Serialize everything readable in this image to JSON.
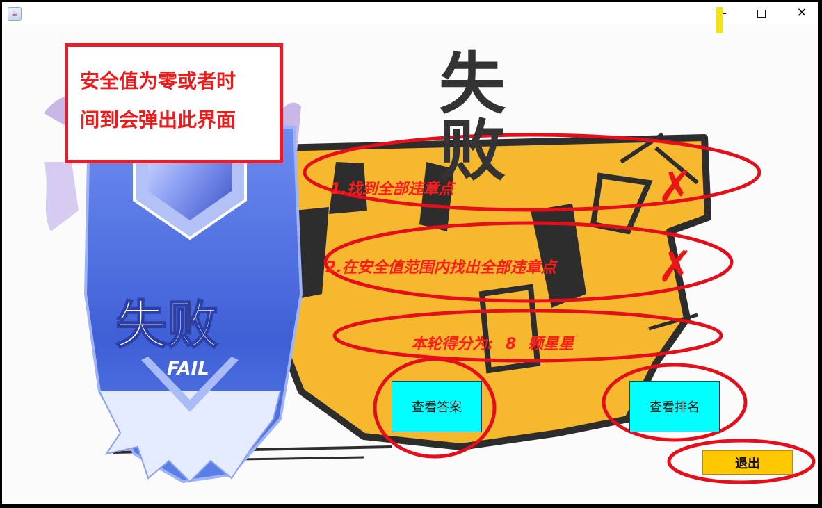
{
  "window": {
    "app_icon": "java-cup-icon",
    "minimize_label": "—",
    "maximize_icon": "maximize-icon",
    "close_label": "✕"
  },
  "title": "失 败",
  "background": {
    "badge_text": "失败",
    "badge_subtext": "FAIL",
    "graffiti_text": "失败"
  },
  "annotation": {
    "line1": "安全值为零或者时",
    "line2": "间到会弹出此界面"
  },
  "conditions": [
    {
      "text": "1.找到全部违章点",
      "mark": "✗"
    },
    {
      "text": "2.在安全值范围内找出全部违章点",
      "mark": "✗"
    }
  ],
  "score": {
    "prefix": "本轮得分为:",
    "value": "8",
    "suffix": "颗星星"
  },
  "buttons": {
    "view_answer": "查看答案",
    "view_ranking": "查看排名",
    "exit": "退出"
  },
  "colors": {
    "annotation_red": "#e71d2b",
    "cyan_button": "#00ffff",
    "exit_button": "#ffc800",
    "graffiti_yellow": "#f5b82e"
  }
}
